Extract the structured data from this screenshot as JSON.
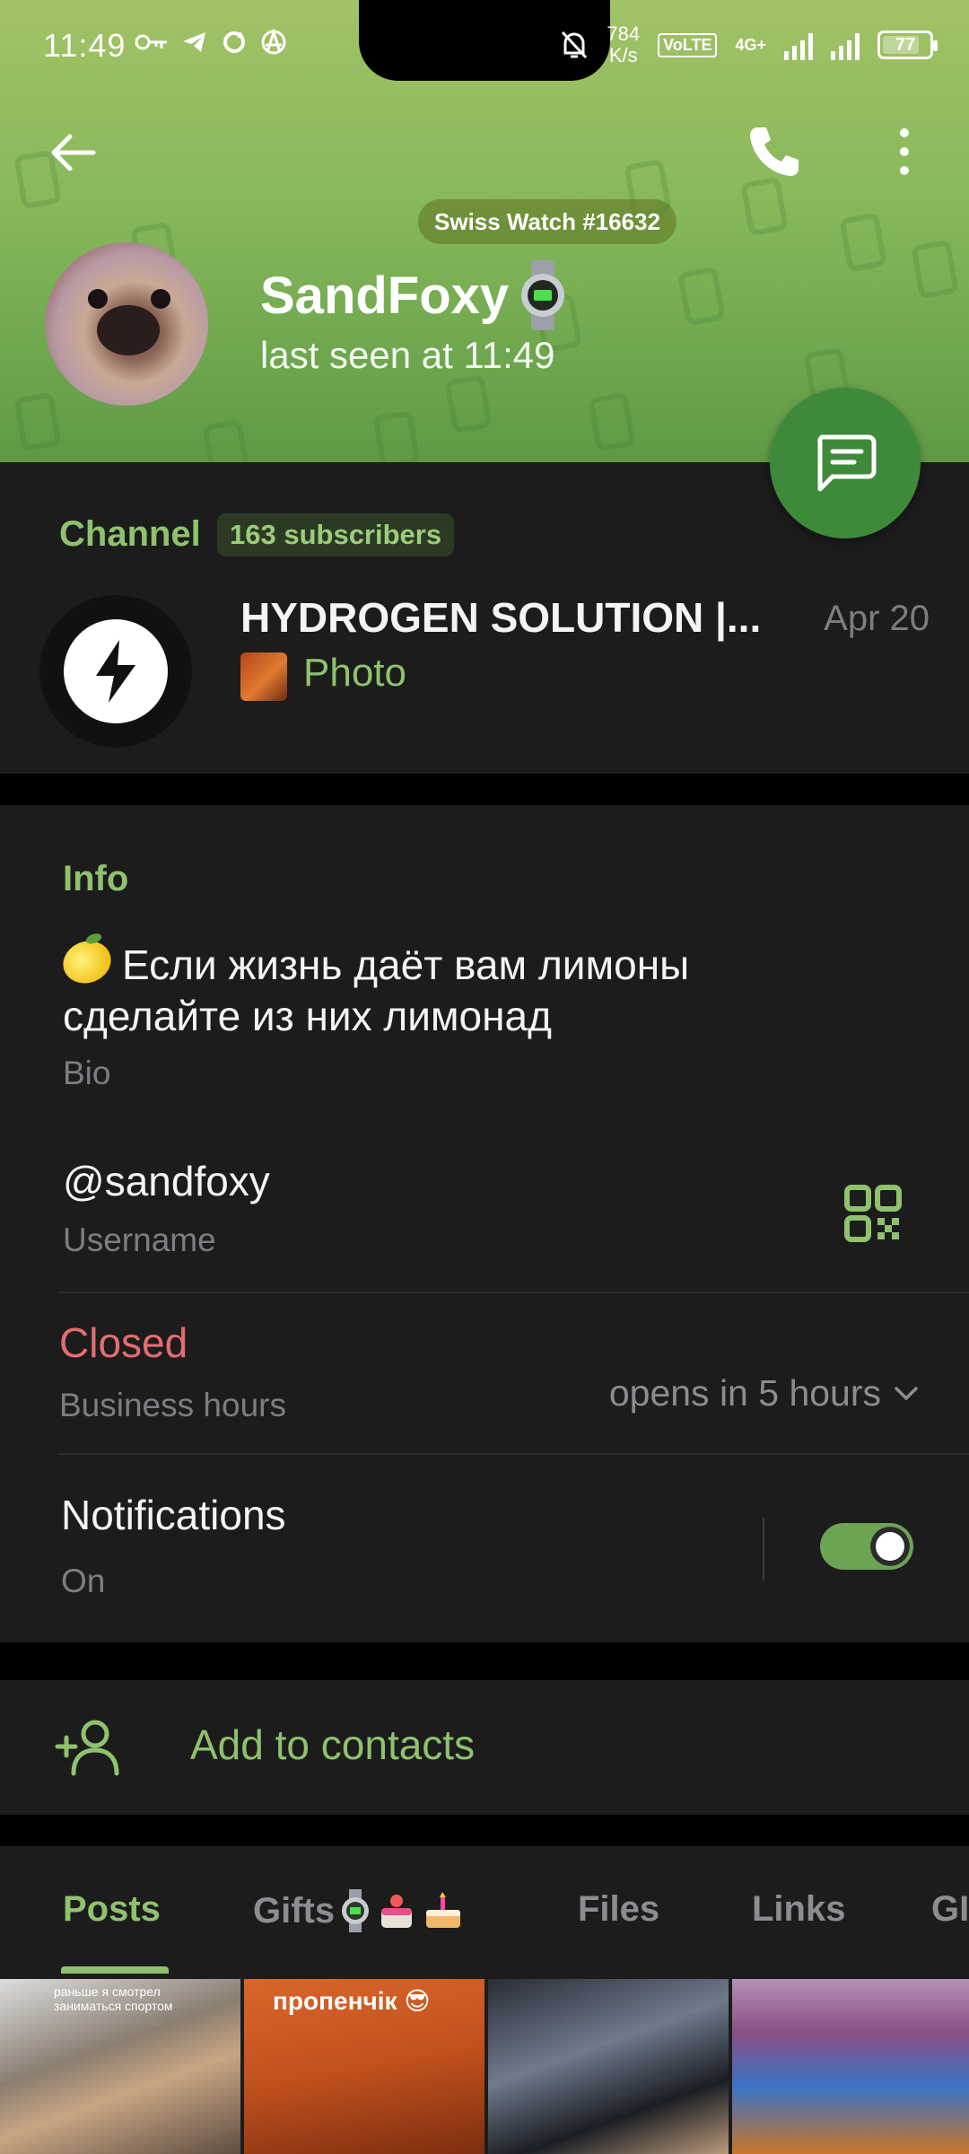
{
  "status_bar": {
    "time": "11:49",
    "net_speed_value": "784",
    "net_speed_unit": "K/s",
    "volte": "VoLTE",
    "network": "4G+",
    "battery": "77"
  },
  "header": {
    "gift_badge": "Swiss Watch #16632",
    "name": "SandFoxy",
    "last_seen": "last seen at 11:49",
    "colors": {
      "top": "#a3c266",
      "bottom": "#5e9a45",
      "fab": "#3f8a3a"
    }
  },
  "channel": {
    "label": "Channel",
    "subscribers": "163 subscribers",
    "title": "HYDROGEN SOLUTION |...",
    "date": "Apr 20",
    "last_message": "Photo"
  },
  "info": {
    "title": "Info",
    "bio": "Если жизнь даёт вам лимоны сделайте из них лимонад",
    "bio_label": "Bio",
    "username": "@sandfoxy",
    "username_label": "Username",
    "business_status": "Closed",
    "business_label": "Business hours",
    "opens_in": "opens in 5 hours",
    "notifications_label": "Notifications",
    "notifications_state": "On",
    "notifications_enabled": true
  },
  "actions": {
    "add_contact": "Add to contacts"
  },
  "tabs": [
    {
      "label": "Posts",
      "active": true
    },
    {
      "label": "Gifts",
      "active": false
    },
    {
      "label": "Files",
      "active": false
    },
    {
      "label": "Links",
      "active": false
    },
    {
      "label": "GI",
      "active": false
    }
  ],
  "media": [
    {
      "caption": "раньше я смотрел заниматься спортом"
    },
    {
      "caption": "пропенчік 😎"
    },
    {
      "caption": ""
    },
    {
      "caption": ""
    }
  ],
  "accent_color": "#8fc26c",
  "danger_color": "#e46d6f"
}
